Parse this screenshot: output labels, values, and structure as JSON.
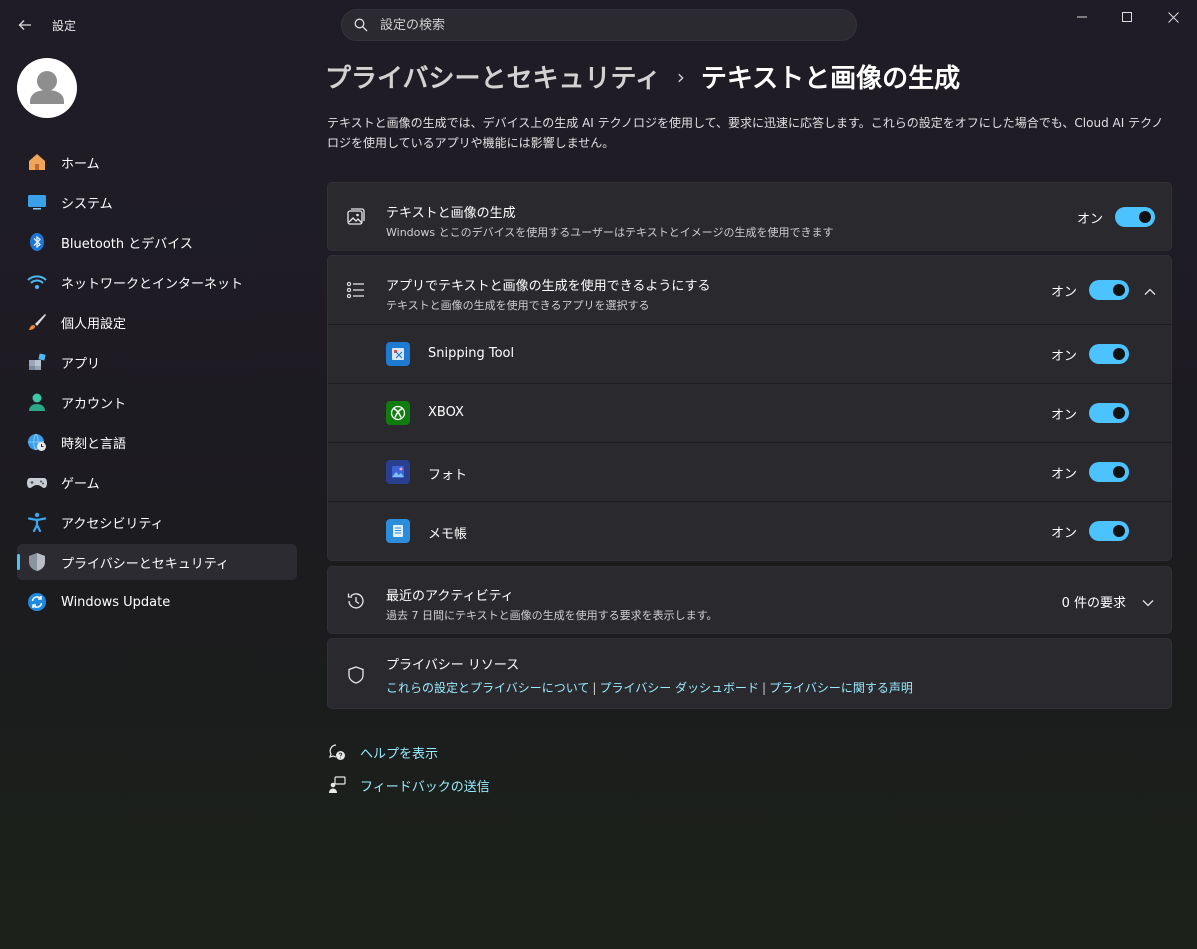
{
  "window": {
    "title": "設定"
  },
  "search": {
    "placeholder": "設定の検索"
  },
  "sidebar": {
    "items": [
      {
        "label": "ホーム",
        "icon": "home-icon"
      },
      {
        "label": "システム",
        "icon": "system-icon"
      },
      {
        "label": "Bluetooth とデバイス",
        "icon": "bluetooth-icon"
      },
      {
        "label": "ネットワークとインターネット",
        "icon": "wifi-icon"
      },
      {
        "label": "個人用設定",
        "icon": "brush-icon"
      },
      {
        "label": "アプリ",
        "icon": "apps-icon"
      },
      {
        "label": "アカウント",
        "icon": "account-icon"
      },
      {
        "label": "時刻と言語",
        "icon": "globe-clock-icon"
      },
      {
        "label": "ゲーム",
        "icon": "gamepad-icon"
      },
      {
        "label": "アクセシビリティ",
        "icon": "accessibility-icon"
      },
      {
        "label": "プライバシーとセキュリティ",
        "icon": "shield-icon",
        "active": true
      },
      {
        "label": "Windows Update",
        "icon": "update-icon"
      }
    ]
  },
  "header": {
    "parent": "プライバシーとセキュリティ",
    "current": "テキストと画像の生成",
    "description": "テキストと画像の生成では、デバイス上の生成 AI テクノロジを使用して、要求に迅速に応答します。これらの設定をオフにした場合でも、Cloud AI テクノロジを使用しているアプリや機能には影響しません。"
  },
  "main_setting": {
    "title": "テキストと画像の生成",
    "subtitle": "Windows とこのデバイスを使用するユーザーはテキストとイメージの生成を使用できます",
    "state": "オン"
  },
  "apps_setting": {
    "title": "アプリでテキストと画像の生成を使用できるようにする",
    "subtitle": "テキストと画像の生成を使用できるアプリを選択する",
    "state": "オン",
    "apps": [
      {
        "name": "Snipping Tool",
        "state": "オン"
      },
      {
        "name": "XBOX",
        "state": "オン"
      },
      {
        "name": "フォト",
        "state": "オン"
      },
      {
        "name": "メモ帳",
        "state": "オン"
      }
    ]
  },
  "activity": {
    "title": "最近のアクティビティ",
    "subtitle": "過去 7 日間にテキストと画像の生成を使用する要求を表示します。",
    "count": "0 件の要求"
  },
  "privacy": {
    "title": "プライバシー リソース",
    "link1": "これらの設定とプライバシーについて",
    "link2": "プライバシー ダッシュボード",
    "link3": "プライバシーに関する声明",
    "separator": "|"
  },
  "help": {
    "help_label": "ヘルプを表示",
    "feedback_label": "フィードバックの送信"
  },
  "colors": {
    "accent": "#4cc2ff",
    "link": "#99ebff",
    "card": "#2a292e"
  }
}
